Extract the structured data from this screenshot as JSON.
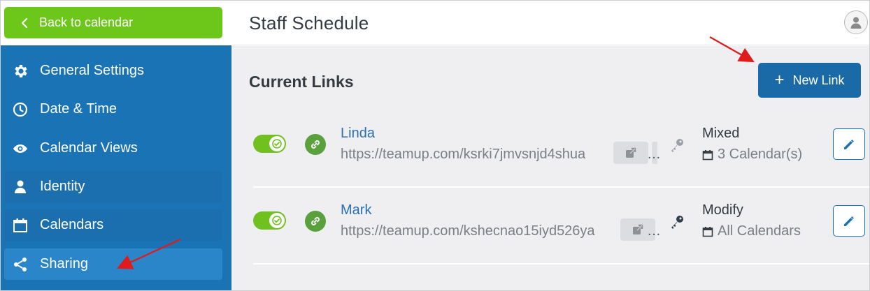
{
  "sidebar": {
    "back_label": "Back to calendar",
    "items": [
      {
        "label": "General Settings",
        "icon": "gear-icon"
      },
      {
        "label": "Date & Time",
        "icon": "clock-icon"
      },
      {
        "label": "Calendar Views",
        "icon": "eye-icon"
      },
      {
        "label": "Identity",
        "icon": "person-icon"
      },
      {
        "label": "Calendars",
        "icon": "calendar-icon"
      },
      {
        "label": "Sharing",
        "icon": "share-icon"
      }
    ]
  },
  "header": {
    "title": "Staff Schedule"
  },
  "main": {
    "section_title": "Current Links",
    "new_link_plus": "+",
    "new_link_label": "New Link",
    "links": [
      {
        "enabled": true,
        "name": "Linda",
        "url": "https://teamup.com/ksrki7jmvsnjd4shua",
        "ellipsis": "…",
        "permission": "Mixed",
        "calendars": "3 Calendar(s)",
        "key_color": "#9aa0a6"
      },
      {
        "enabled": true,
        "name": "Mark",
        "url": "https://teamup.com/kshecnao15iyd526ya",
        "ellipsis": "…",
        "permission": "Modify",
        "calendars": "All Calendars",
        "key_color": "#2f3e4c"
      }
    ]
  },
  "colors": {
    "sidebar_blue": "#1a73b5",
    "green": "#6cc71a",
    "button_blue": "#1a6aa8",
    "annotation_red": "#e01b1b"
  }
}
